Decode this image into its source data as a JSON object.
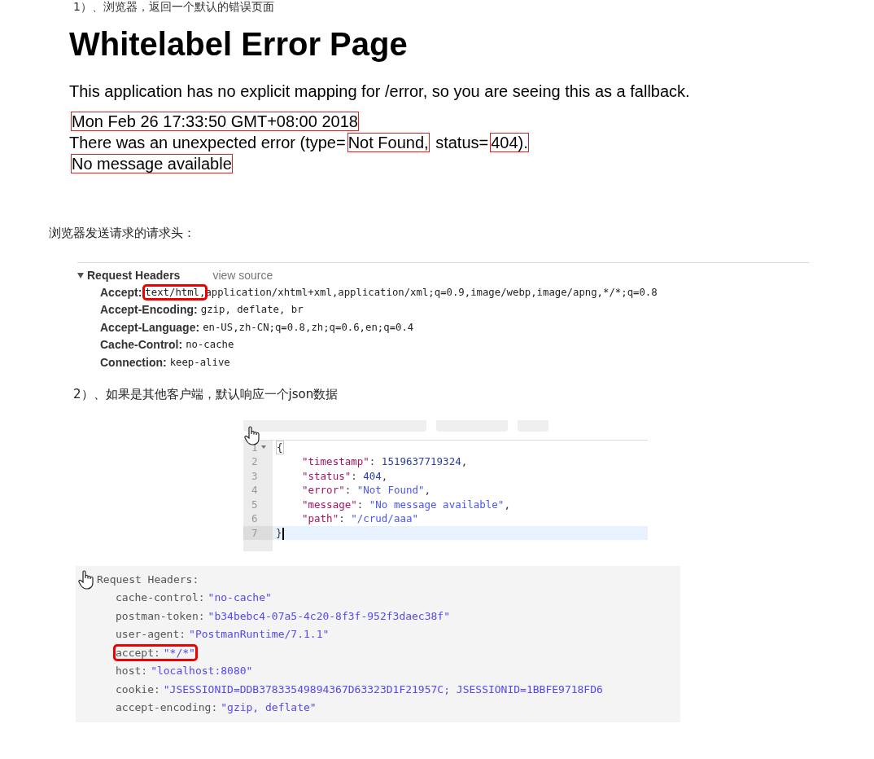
{
  "intro": "1）、浏览器，返回一个默认的错误页面",
  "error_page": {
    "title": "Whitelabel Error Page",
    "description": "This application has no explicit mapping for /error, so you are seeing this as a fallback.",
    "lines": [
      {
        "segments": [
          {
            "text": "Mon Feb 26 17:33:50 GMT+08:00 2018",
            "highlighted": true
          }
        ]
      },
      {
        "segments": [
          {
            "text": "There was an unexpected error (type=",
            "highlighted": false
          },
          {
            "text": "Not Found,",
            "highlighted": true
          },
          {
            "text": " status=",
            "highlighted": false
          },
          {
            "text": "404).",
            "highlighted": true
          }
        ]
      },
      {
        "segments": [
          {
            "text": "No message available",
            "highlighted": true
          }
        ]
      }
    ]
  },
  "caption_1": "浏览器发送请求的请求头：",
  "browser_headers": {
    "title": "Request Headers",
    "expanded": true,
    "view_source": "view source",
    "headers": [
      {
        "name": "Accept:",
        "segments": [
          {
            "text": "text/html,",
            "highlighted": true
          },
          {
            "text": "application/xhtml+xml,application/xml;q=0.9,image/webp,image/apng,*/*;q=0.8",
            "highlighted": false
          }
        ]
      },
      {
        "name": "Accept-Encoding:",
        "segments": [
          {
            "text": "gzip, deflate, br",
            "highlighted": false
          }
        ]
      },
      {
        "name": "Accept-Language:",
        "segments": [
          {
            "text": "en-US,zh-CN;q=0.8,zh;q=0.6,en;q=0.4",
            "highlighted": false
          }
        ]
      },
      {
        "name": "Cache-Control:",
        "segments": [
          {
            "text": "no-cache",
            "highlighted": false
          }
        ]
      },
      {
        "name": "Connection:",
        "segments": [
          {
            "text": "keep-alive",
            "highlighted": false
          }
        ]
      }
    ]
  },
  "caption_2": "2）、如果是其他客户端，默认响应一个json数据",
  "json_editor": {
    "lines": [
      {
        "number": "1",
        "foldable": true,
        "selected": false,
        "tokens": [
          {
            "kind": "bracket",
            "text": "{"
          }
        ]
      },
      {
        "number": "2",
        "foldable": false,
        "selected": false,
        "tokens": [
          {
            "kind": "key",
            "text": "\"timestamp\""
          },
          {
            "kind": "punct",
            "text": ": "
          },
          {
            "kind": "number",
            "text": "1519637719324"
          },
          {
            "kind": "punct",
            "text": ","
          }
        ]
      },
      {
        "number": "3",
        "foldable": false,
        "selected": false,
        "tokens": [
          {
            "kind": "key",
            "text": "\"status\""
          },
          {
            "kind": "punct",
            "text": ": "
          },
          {
            "kind": "number",
            "text": "404"
          },
          {
            "kind": "punct",
            "text": ","
          }
        ]
      },
      {
        "number": "4",
        "foldable": false,
        "selected": false,
        "tokens": [
          {
            "kind": "key",
            "text": "\"error\""
          },
          {
            "kind": "punct",
            "text": ": "
          },
          {
            "kind": "string",
            "text": "\"Not Found\""
          },
          {
            "kind": "punct",
            "text": ","
          }
        ]
      },
      {
        "number": "5",
        "foldable": false,
        "selected": false,
        "tokens": [
          {
            "kind": "key",
            "text": "\"message\""
          },
          {
            "kind": "punct",
            "text": ": "
          },
          {
            "kind": "string",
            "text": "\"No message available\""
          },
          {
            "kind": "punct",
            "text": ","
          }
        ]
      },
      {
        "number": "6",
        "foldable": false,
        "selected": false,
        "tokens": [
          {
            "kind": "key",
            "text": "\"path\""
          },
          {
            "kind": "punct",
            "text": ": "
          },
          {
            "kind": "string",
            "text": "\"/crud/aaa\""
          }
        ]
      },
      {
        "number": "7",
        "foldable": false,
        "selected": true,
        "tokens": [
          {
            "kind": "punct",
            "text": "}"
          }
        ]
      }
    ]
  },
  "postman_headers": {
    "title": "Request Headers:",
    "headers": [
      {
        "name": "cache-control:",
        "value": "\"no-cache\"",
        "highlighted": false
      },
      {
        "name": "postman-token:",
        "value": "\"b34bebc4-07a5-4c20-8f3f-952f3daec38f\"",
        "highlighted": false
      },
      {
        "name": "user-agent:",
        "value": "\"PostmanRuntime/7.1.1\"",
        "highlighted": false
      },
      {
        "name": "accept:",
        "value": "\"*/*\"",
        "highlighted": true
      },
      {
        "name": "host:",
        "value": "\"localhost:8080\"",
        "highlighted": false
      },
      {
        "name": "cookie:",
        "value": "\"JSESSIONID=DDB37833549894367D63323D1F21957C; JSESSIONID=1BBFE9718FD6",
        "highlighted": false
      },
      {
        "name": "accept-encoding:",
        "value": "\"gzip, deflate\"",
        "highlighted": false
      }
    ]
  }
}
